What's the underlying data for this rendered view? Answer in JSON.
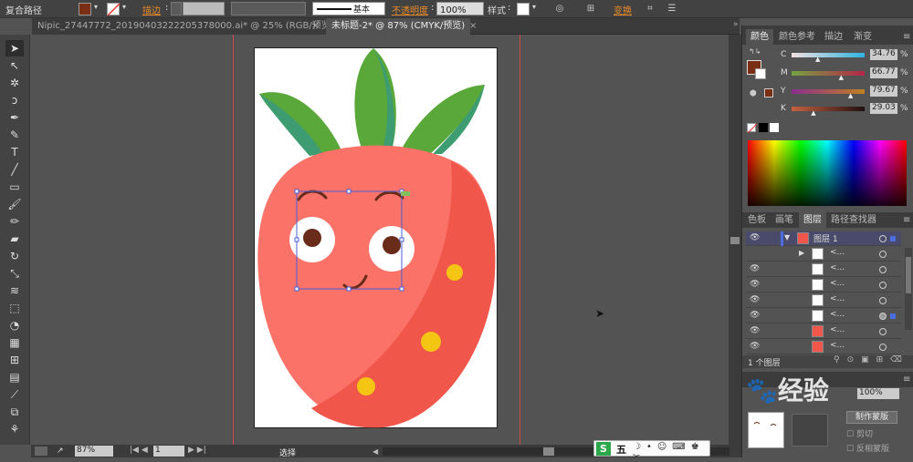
{
  "control_bar": {
    "selection_label": "复合路径",
    "stroke_label": "描边",
    "stroke_profile": "基本",
    "opacity_label": "不透明度",
    "opacity_value": "100%",
    "style_label": "样式",
    "transform_label": "变换",
    "fill_color": "#7a2e14"
  },
  "tabs": [
    {
      "label": "Nipic_27447772_20190403222205378000.ai* @ 25% (RGB/预览)",
      "close": "×"
    },
    {
      "label": "未标题-2* @ 87% (CMYK/预览)",
      "close": "×"
    }
  ],
  "tools": [
    "selection-tool",
    "direct-selection-tool",
    "magic-wand-tool",
    "lasso-tool",
    "pen-tool",
    "curvature-tool",
    "type-tool",
    "line-tool",
    "rectangle-tool",
    "paintbrush-tool",
    "pencil-tool",
    "eraser-tool",
    "rotate-tool",
    "scale-tool",
    "width-tool",
    "free-transform-tool",
    "shape-builder-tool",
    "perspective-tool",
    "mesh-tool",
    "gradient-tool",
    "eyedropper-tool",
    "blend-tool",
    "symbol-sprayer-tool",
    "graph-tool"
  ],
  "status": {
    "zoom": "87%",
    "page": "1",
    "mode": "选择"
  },
  "color_panel": {
    "tabs": [
      "颜色",
      "颜色参考",
      "描边",
      "渐变"
    ],
    "channels": [
      {
        "label": "C",
        "value": "34.76",
        "pct": 0.35
      },
      {
        "label": "M",
        "value": "66.77",
        "pct": 0.67
      },
      {
        "label": "Y",
        "value": "79.67",
        "pct": 0.8
      },
      {
        "label": "K",
        "value": "29.03",
        "pct": 0.29
      }
    ],
    "unit": "%"
  },
  "layers_panel": {
    "tabs": [
      "色板",
      "画笔",
      "图层",
      "路径查找器"
    ],
    "layer_name": "图层 1",
    "sublayer_label": "<...",
    "footer": "1 个图层"
  },
  "transparency_panel": {
    "opacity_value": "100%",
    "make_mask_button": "制作蒙版",
    "clip_label": "剪切",
    "invert_label": "反相蒙版"
  },
  "overlays": {
    "watermark": "经验",
    "ime_label": "五"
  },
  "colors": {
    "strawberry": "#f0574a",
    "strawberry_light": "#fb7268",
    "leaf": "#5aa83a",
    "leaf_dark": "#3d9c71",
    "seed": "#f4c613",
    "eye_pupil": "#6a2c1a",
    "selection": "#4a5fd8"
  }
}
